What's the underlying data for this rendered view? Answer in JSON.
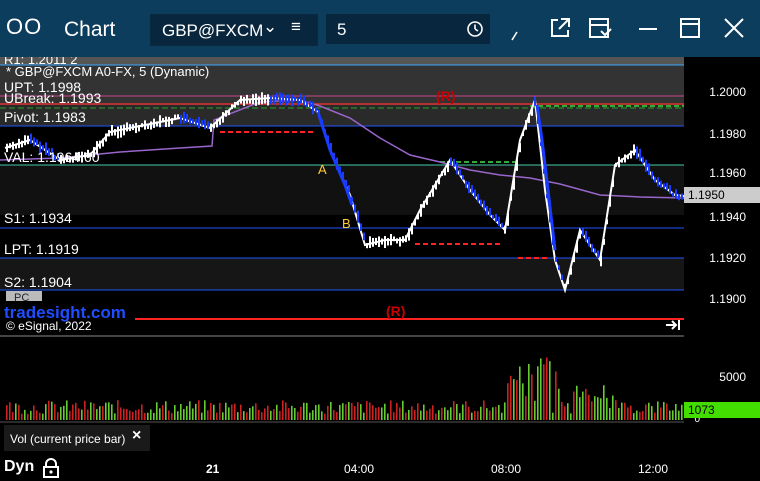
{
  "window": {
    "app_title": "Chart",
    "symbol": "GBP@FXCM",
    "interval": "5"
  },
  "chart": {
    "header_line_1": "R1: 1.2011 2",
    "header_line_2": "* GBP@FXCM A0-FX, 5 (Dynamic)",
    "levels": {
      "upt": "UPT: 1.1998",
      "ubreak": "UBreak: 1.1993",
      "pivot": "Pivot: 1.1983",
      "val": "VAL: 1.1964.60",
      "s1": "S1: 1.1934",
      "lpt": "LPT: 1.1919",
      "s2": "S2: 1.1904"
    },
    "markers": {
      "r1": "(R)",
      "r2": "(R)",
      "a": "A",
      "b": "B"
    },
    "watermark": "tradesight.com",
    "copyright": "© eSignal, 2022",
    "pc_label": "PC",
    "price_ticks": [
      "1.2000",
      "1.1980",
      "1.1960",
      "1.1940",
      "1.1920",
      "1.1900"
    ],
    "last_price": "1.1950"
  },
  "volume": {
    "tick_label": "5000",
    "zero_label": "0",
    "last_volume": "1073",
    "legend": "Vol (current price bar)"
  },
  "time_axis": {
    "ticks": [
      "21",
      "04:00",
      "08:00",
      "12:00"
    ],
    "mode": "Dyn"
  },
  "colors": {
    "titlebar": "#0c3d5c",
    "up_bar": "#ffffff",
    "down_bar": "#1a3cff",
    "vol_up": "#66cc33",
    "vol_down": "#cc2222",
    "vwap": "#9966cc"
  }
}
